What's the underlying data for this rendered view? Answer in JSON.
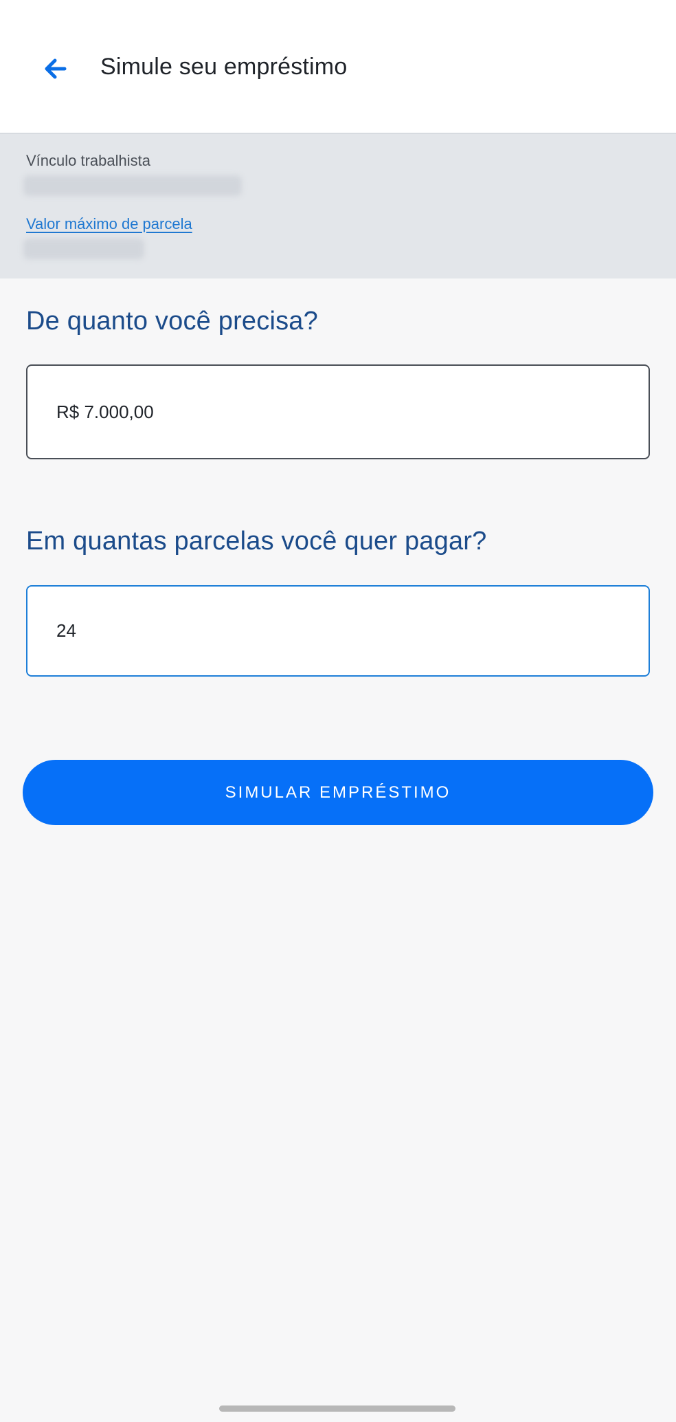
{
  "header": {
    "title": "Simule seu empréstimo",
    "back_icon": "arrow-left-icon"
  },
  "info_panel": {
    "employment_label": "Vínculo trabalhista",
    "max_installment_link": "Valor máximo de parcela"
  },
  "form": {
    "amount_question": "De quanto você precisa?",
    "amount_value": "R$ 7.000,00",
    "installments_question": "Em quantas parcelas você quer pagar?",
    "installments_value": "24"
  },
  "actions": {
    "simulate_label": "SIMULAR EMPRÉSTIMO"
  },
  "colors": {
    "accent": "#0670f8",
    "question_text": "#1b4b8a",
    "link": "#1f78d1",
    "panel_bg": "#e3e6ea"
  }
}
